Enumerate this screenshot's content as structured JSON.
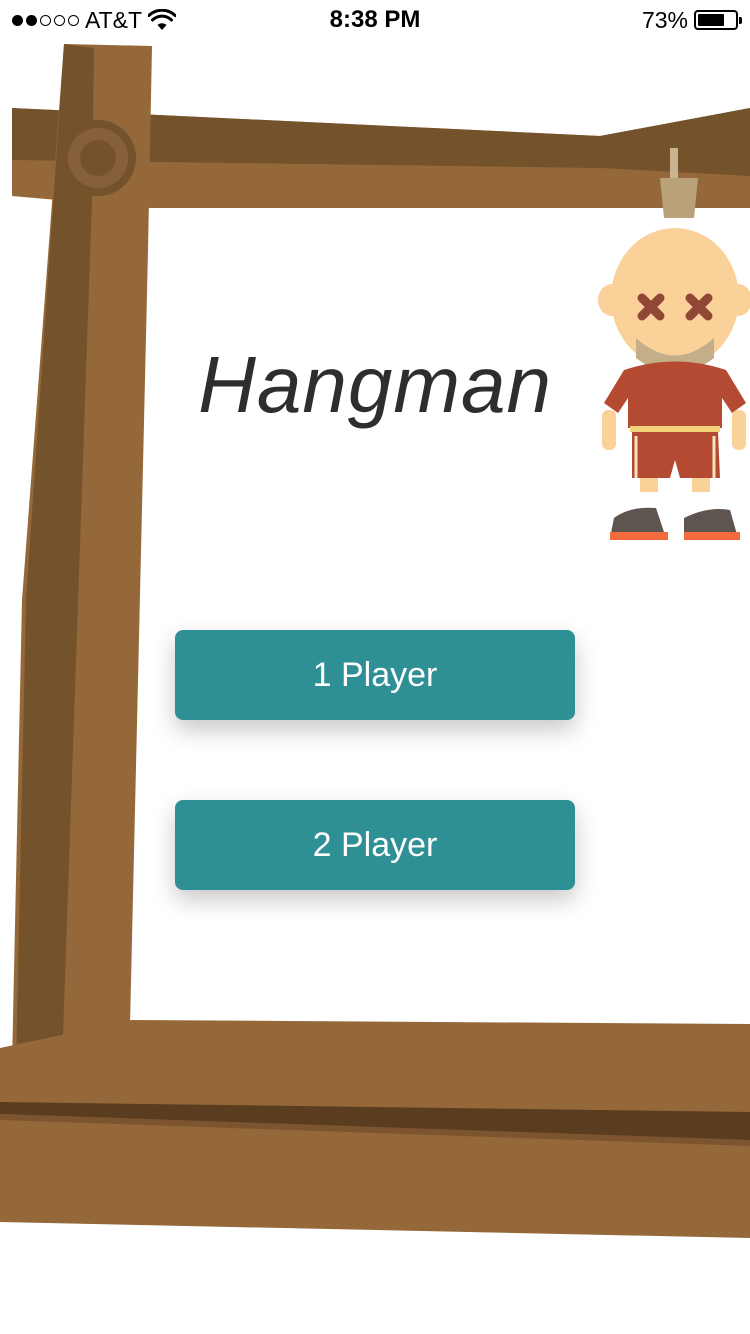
{
  "status_bar": {
    "carrier": "AT&T",
    "time": "8:38 PM",
    "battery_percent": "73%",
    "battery_level": 0.73,
    "signal_bars_filled": 2,
    "signal_bars_total": 5
  },
  "title": "Hangman",
  "buttons": {
    "one_player": "1 Player",
    "two_player": "2 Player"
  },
  "colors": {
    "button": "#2e8f95",
    "wood_light": "#95683a",
    "wood_dark": "#74532c"
  }
}
